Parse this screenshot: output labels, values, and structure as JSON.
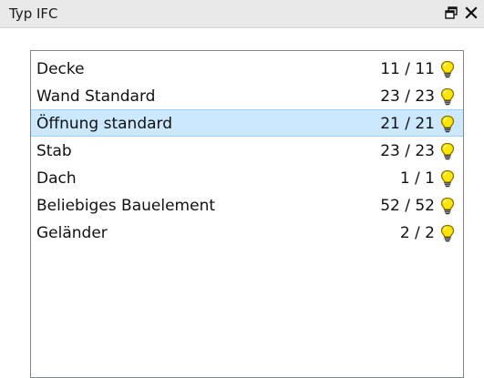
{
  "panel": {
    "title": "Typ IFC",
    "restore_icon": "float-window-icon",
    "close_icon": "close-icon"
  },
  "list": {
    "items": [
      {
        "label": "Decke",
        "count": "11 / 11",
        "visible": true,
        "selected": false
      },
      {
        "label": "Wand Standard",
        "count": "23 / 23",
        "visible": true,
        "selected": false
      },
      {
        "label": "Öffnung standard",
        "count": "21 / 21",
        "visible": true,
        "selected": true
      },
      {
        "label": "Stab",
        "count": "23 / 23",
        "visible": true,
        "selected": false
      },
      {
        "label": "Dach",
        "count": "1 / 1",
        "visible": true,
        "selected": false
      },
      {
        "label": "Beliebiges Bauelement",
        "count": "52 / 52",
        "visible": true,
        "selected": false
      },
      {
        "label": "Geländer",
        "count": "2 / 2",
        "visible": true,
        "selected": false
      }
    ],
    "bulb_icon": "lightbulb-icon"
  },
  "colors": {
    "selection_bg": "#cce8ff",
    "selection_border": "#99d1ff",
    "bulb_fill": "#ffe600",
    "bulb_outline": "#8a7400"
  }
}
